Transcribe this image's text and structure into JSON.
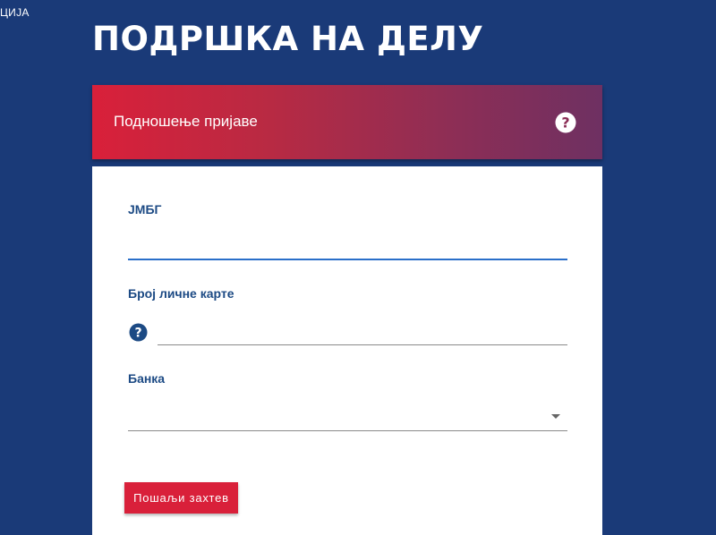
{
  "corner": {
    "text": "ЦИЈА"
  },
  "page": {
    "title": "ПОДРШКА НА ДЕЛУ"
  },
  "card": {
    "header_title": "Подношење пријаве",
    "help_icon": "question-circle-icon"
  },
  "form": {
    "jmbg": {
      "label": "ЈМБГ",
      "value": "",
      "placeholder": ""
    },
    "id_card": {
      "label": "Број личне карте",
      "value": "",
      "placeholder": "",
      "help_icon": "question-circle-icon"
    },
    "bank": {
      "label": "Банка",
      "selected": ""
    },
    "submit_label": "Пошаљи захтев"
  },
  "colors": {
    "background": "#1a3a78",
    "header_gradient_start": "#d9203a",
    "header_gradient_end": "#6e3062",
    "label": "#1c4a84",
    "active_underline": "#2a6fc9",
    "button": "#d9203a"
  }
}
